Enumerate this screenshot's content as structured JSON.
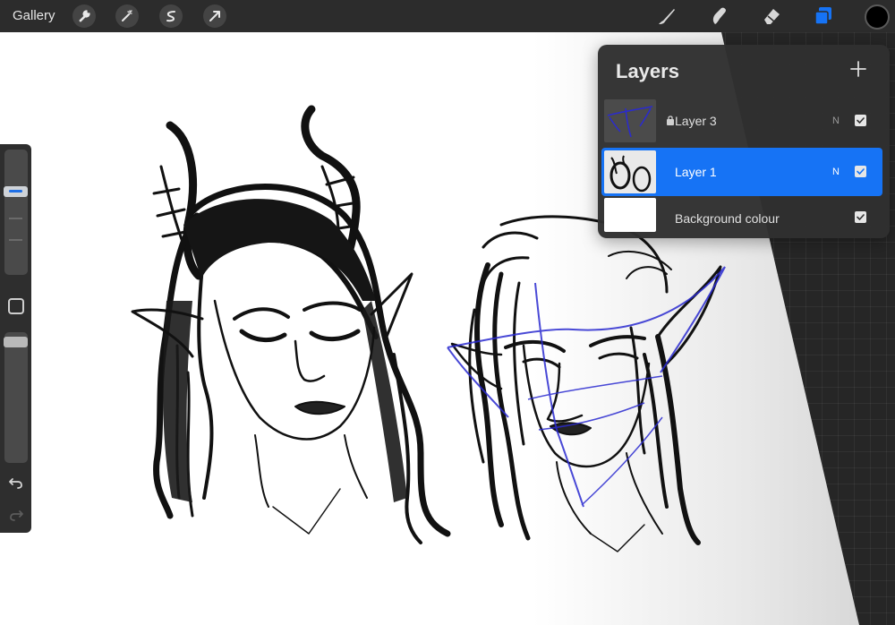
{
  "toolbar": {
    "gallery_label": "Gallery",
    "left_tools": [
      "wrench-icon",
      "magic-wand-icon",
      "selection-icon",
      "transform-arrow-icon"
    ],
    "right_tools": [
      "brush-icon",
      "smudge-icon",
      "eraser-icon",
      "layers-icon"
    ],
    "active_tool": "layers-icon",
    "current_color": "#000000"
  },
  "sidebar": {
    "brush_size_level": 0.32,
    "brush_opacity_level": 0.04,
    "controls": [
      "modifier-square-icon",
      "undo-icon",
      "redo-icon"
    ]
  },
  "layers_panel": {
    "title": "Layers",
    "add_icon": "plus-icon",
    "layers": [
      {
        "name": "Layer 3",
        "blend_mode": "N",
        "visible": true,
        "locked": true,
        "selected": false
      },
      {
        "name": "Layer 1",
        "blend_mode": "N",
        "visible": true,
        "locked": false,
        "selected": true
      },
      {
        "name": "Background colour",
        "blend_mode": "",
        "visible": true,
        "locked": false,
        "selected": false
      }
    ]
  },
  "colors": {
    "accent": "#1673f5",
    "panel_bg": "#303030",
    "toolbar_bg": "#2c2c2c",
    "guide_line": "#2a2ad0"
  }
}
